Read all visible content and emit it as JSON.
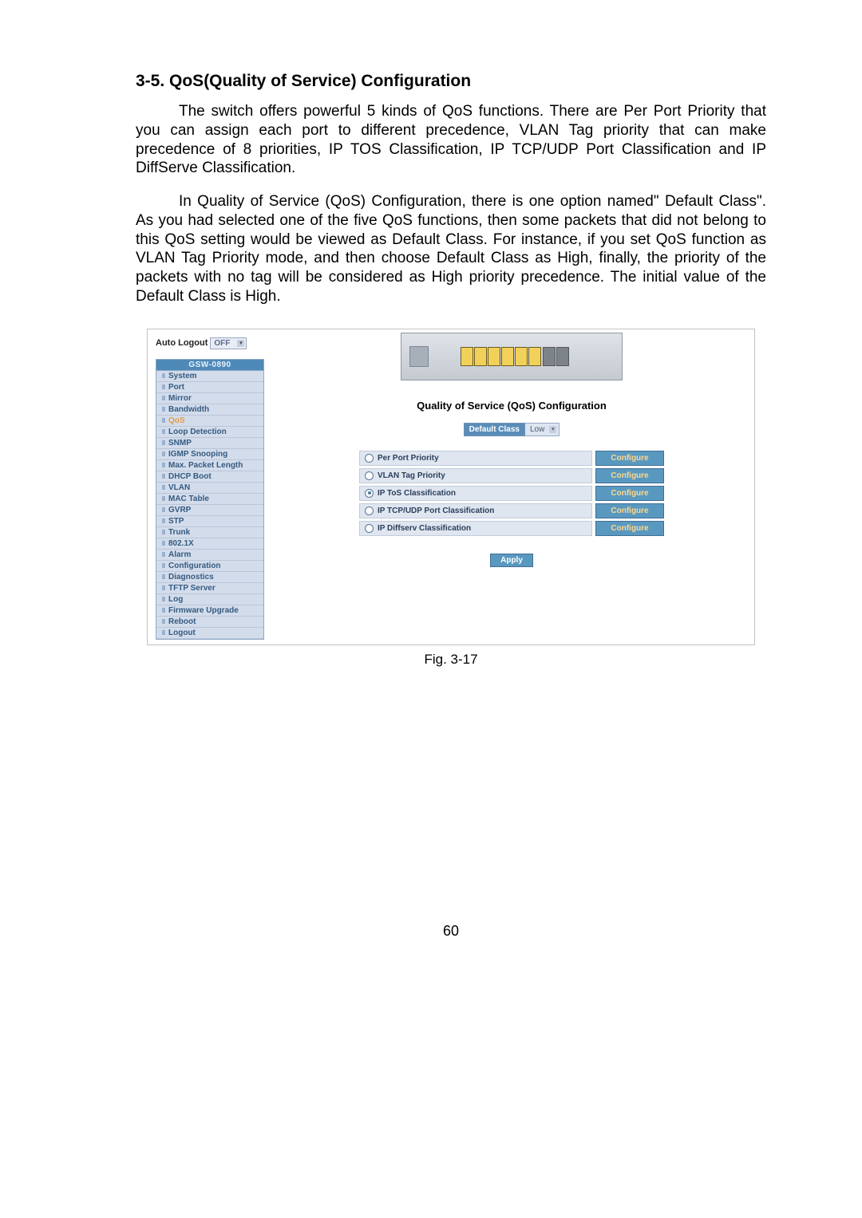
{
  "section_heading": "3-5. QoS(Quality of Service) Configuration",
  "para1": "The switch offers powerful 5 kinds of QoS functions. There are Per Port Priority that you can assign each port to different precedence,  VLAN Tag priority that can make precedence of 8 priorities, IP TOS Classification, IP TCP/UDP Port Classification and IP DiffServe Classification.",
  "para2": "In Quality of Service (QoS) Configuration, there is one option named\" Default Class\". As you had selected one of the five QoS functions, then some packets that did not belong to this QoS setting would be viewed as Default Class. For instance, if you set QoS function as VLAN Tag Priority mode, and then choose Default Class as High, finally, the priority of the packets with no tag will be considered as High priority precedence.  The initial value of the Default Class is High.",
  "screenshot": {
    "auto_logout_label": "Auto Logout",
    "auto_logout_value": "OFF",
    "nav_title": "GSW-0890",
    "nav_items": [
      {
        "label": "System",
        "active": false
      },
      {
        "label": "Port",
        "active": false
      },
      {
        "label": "Mirror",
        "active": false
      },
      {
        "label": "Bandwidth",
        "active": false
      },
      {
        "label": "QoS",
        "active": true
      },
      {
        "label": "Loop Detection",
        "active": false
      },
      {
        "label": "SNMP",
        "active": false
      },
      {
        "label": "IGMP Snooping",
        "active": false
      },
      {
        "label": "Max. Packet Length",
        "active": false
      },
      {
        "label": "DHCP Boot",
        "active": false
      },
      {
        "label": "VLAN",
        "active": false
      },
      {
        "label": "MAC Table",
        "active": false
      },
      {
        "label": "GVRP",
        "active": false
      },
      {
        "label": "STP",
        "active": false
      },
      {
        "label": "Trunk",
        "active": false
      },
      {
        "label": "802.1X",
        "active": false
      },
      {
        "label": "Alarm",
        "active": false
      },
      {
        "label": "Configuration",
        "active": false
      },
      {
        "label": "Diagnostics",
        "active": false
      },
      {
        "label": "TFTP Server",
        "active": false
      },
      {
        "label": "Log",
        "active": false
      },
      {
        "label": "Firmware Upgrade",
        "active": false
      },
      {
        "label": "Reboot",
        "active": false
      },
      {
        "label": "Logout",
        "active": false
      }
    ],
    "qos_title": "Quality of Service (QoS) Configuration",
    "default_class_label": "Default Class",
    "default_class_value": "Low",
    "options": [
      {
        "label": "Per Port Priority",
        "selected": false,
        "btn": "Configure"
      },
      {
        "label": "VLAN Tag Priority",
        "selected": false,
        "btn": "Configure"
      },
      {
        "label": "IP ToS Classification",
        "selected": true,
        "btn": "Configure"
      },
      {
        "label": "IP TCP/UDP Port Classification",
        "selected": false,
        "btn": "Configure"
      },
      {
        "label": "IP Diffserv Classification",
        "selected": false,
        "btn": "Configure"
      }
    ],
    "apply_label": "Apply"
  },
  "figure_caption": "Fig. 3-17",
  "page_number": "60"
}
